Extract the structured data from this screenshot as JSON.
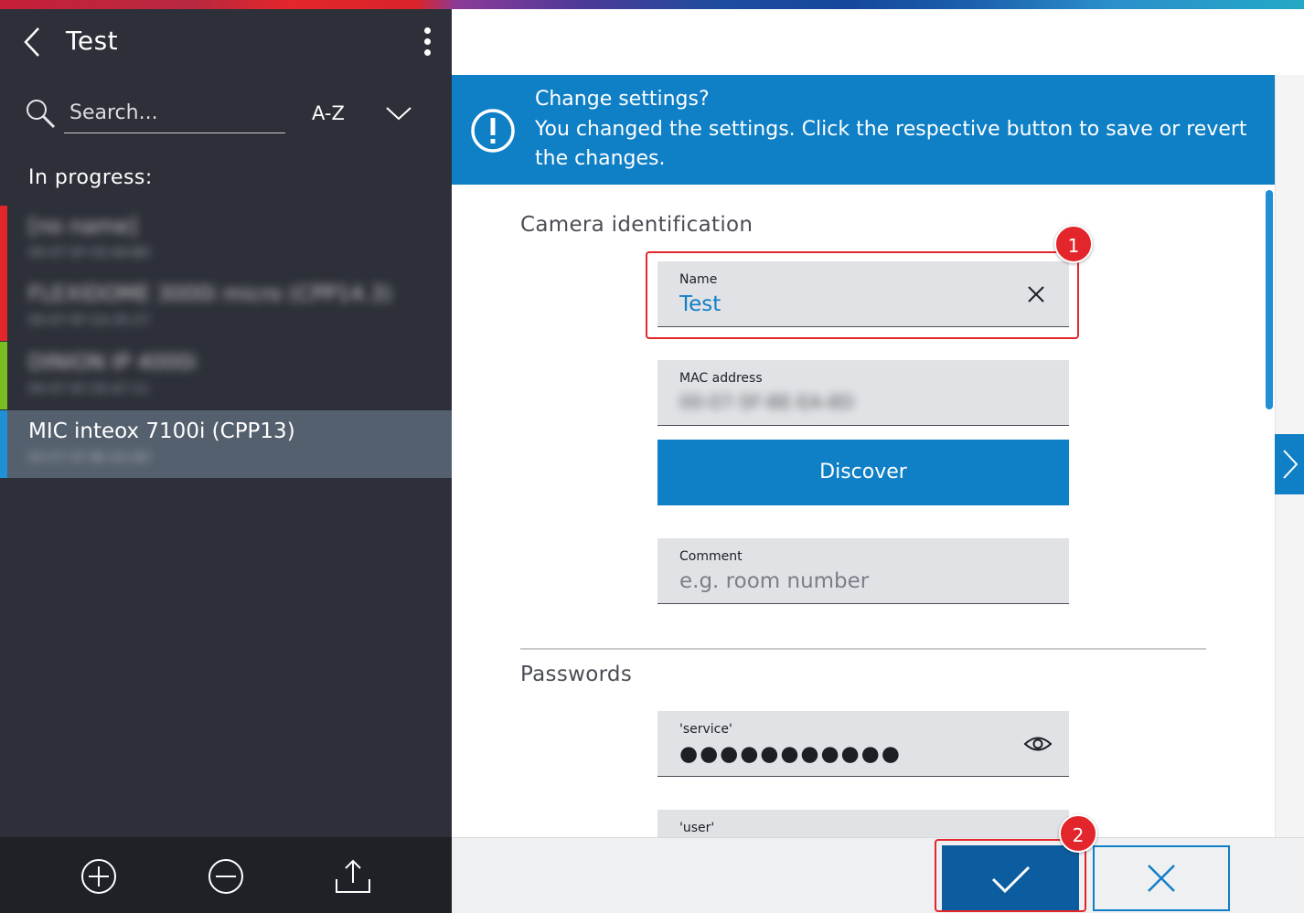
{
  "sidebar": {
    "title": "Test",
    "search": {
      "placeholder": "Search..."
    },
    "sort": {
      "label": "A-Z"
    },
    "section_label": "In progress:",
    "items": [
      {
        "name": "[no name]",
        "detail": "00-07-5F-CE-6A-B0",
        "marker_color": "#e2262b",
        "blurred": true
      },
      {
        "name": "FLEXIDOME 3000i micro (CPP14.3)",
        "detail": "00-07-5F-CA-35-27",
        "marker_color": "#e2262b",
        "blurred": true
      },
      {
        "name": "DINION IP 4000i ",
        "detail": "00-07-5F-CE-A7-11",
        "marker_color": "#78be20",
        "blurred": true
      },
      {
        "name": "MIC inteox 7100i (CPP13)",
        "detail": "00-07-5F-BE-EA-8D",
        "marker_color": "#1f8fd6",
        "blurred": false,
        "selected": true
      }
    ]
  },
  "banner": {
    "title": "Change settings?",
    "message": "You changed the settings. Click the respective button to save or revert the changes."
  },
  "form": {
    "camera_section": "Camera identification",
    "name_field": {
      "label": "Name",
      "value": "Test"
    },
    "mac_field": {
      "label": "MAC address",
      "value": "00-07-5F-BE-EA-8D"
    },
    "discover_label": "Discover",
    "comment_field": {
      "label": "Comment",
      "placeholder": "e.g. room number"
    },
    "passwords_section": "Passwords",
    "service_field": {
      "label": "'service'",
      "value": "●●●●●●●●●●●"
    },
    "user_field": {
      "label": "'user'"
    }
  },
  "annotations": {
    "badge_1": "1",
    "badge_2": "2"
  },
  "colors": {
    "accent": "#0f7fc6",
    "sidebar_bg": "#2d3038",
    "annotation": "#e2262b"
  }
}
